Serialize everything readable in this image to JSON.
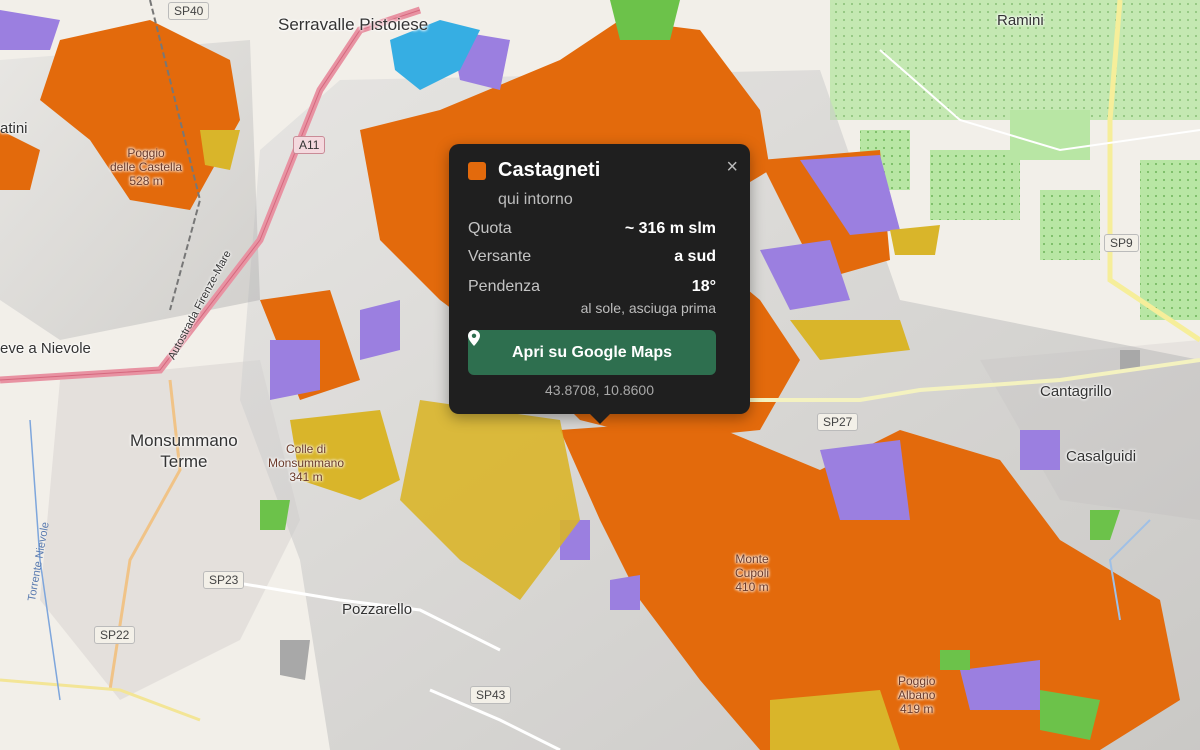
{
  "colors": {
    "castagneti": "#e36a0c",
    "querceti": "#9b7fe0",
    "pinete": "#d9b52a",
    "prati": "#6cc24a",
    "acqua": "#36aee3",
    "base": "#f2efe9",
    "popup_bg": "#1f1f1f",
    "button_bg": "#2e6f4f"
  },
  "map": {
    "place_labels": [
      {
        "text": "Serravalle Pistoiese"
      },
      {
        "text": "Ramini"
      },
      {
        "text": "atini"
      },
      {
        "text": "eve a Nievole"
      },
      {
        "text": "Monsummano\nTerme"
      },
      {
        "text": "Pozzarello"
      },
      {
        "text": "Cantagrillo"
      },
      {
        "text": "Casalguidi"
      }
    ],
    "peak_labels": [
      {
        "text": "Poggio\ndelle Castella\n528 m"
      },
      {
        "text": "Colle di\nMonsummano\n341 m"
      },
      {
        "text": "Monte\nCupoli\n410 m"
      },
      {
        "text": "Poggio\nAlbano\n419 m"
      }
    ],
    "road_labels": [
      {
        "text": "SP40"
      },
      {
        "text": "A11"
      },
      {
        "text": "SP9"
      },
      {
        "text": "SP27"
      },
      {
        "text": "SP23"
      },
      {
        "text": "SP22"
      },
      {
        "text": "SP43"
      }
    ],
    "motorway_label": "Autostrada Firenze-Mare",
    "river_label": "Torrente Nievole"
  },
  "popup": {
    "title": "Castagneti",
    "subtitle": "qui intorno",
    "close_icon": "×",
    "rows": [
      {
        "label": "Quota",
        "value": "~ 316 m slm"
      },
      {
        "label": "Versante",
        "value": "a sud"
      },
      {
        "label": "Pendenza",
        "value": "18°"
      }
    ],
    "note": "al sole, asciuga prima",
    "button_label": "Apri su Google Maps",
    "button_icon": "map-pin-icon",
    "coords": "43.8708, 10.8600"
  }
}
